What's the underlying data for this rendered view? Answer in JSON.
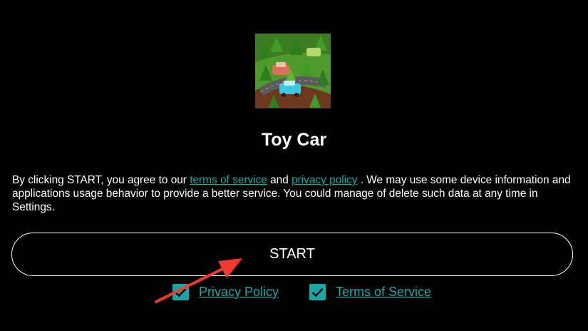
{
  "app": {
    "name": "Toy Car",
    "icon": "toy-car-app-icon"
  },
  "consent": {
    "text_before": "By clicking START, you agree to our ",
    "terms_link": "terms of service",
    "text_and": " and ",
    "privacy_link": "privacy policy",
    "text_after": " . We may use some device information and applications usage behavior to provide a better service. You could manage of delete such data at any time in Settings."
  },
  "start_button": {
    "label": "START"
  },
  "checkboxes": [
    {
      "label": "Privacy Policy",
      "checked": true
    },
    {
      "label": "Terms of Service",
      "checked": true
    }
  ],
  "colors": {
    "background": "#000000",
    "accent": "#1aa6a6",
    "text": "#ffffff",
    "annotation_arrow": "#f03a2e"
  }
}
